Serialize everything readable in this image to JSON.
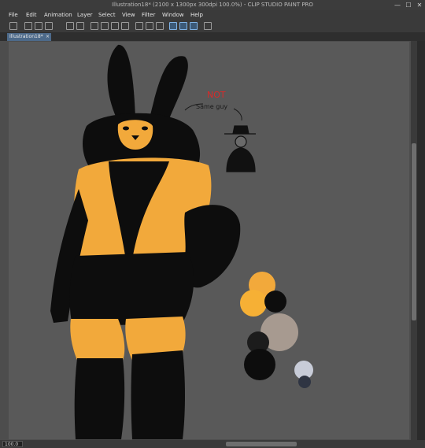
{
  "window": {
    "title": "Illustration18* (2100 x 1300px 300dpi 100.0%)  - CLIP STUDIO PAINT PRO",
    "minimize": "—",
    "maximize": "☐",
    "close": "✕"
  },
  "menu": [
    "File",
    "Edit",
    "Animation",
    "Layer",
    "Select",
    "View",
    "Filter",
    "Window",
    "Help"
  ],
  "tab": {
    "label": "Illustration18*",
    "close": "×"
  },
  "drawing": {
    "annotation_not": "NOT",
    "annotation_same": "Same guy"
  },
  "palette_swatches": [
    "#f2a93b",
    "#f6b035",
    "#0d0d0d",
    "#a79a90",
    "#1c1c1c",
    "#c8ccd8",
    "#2f3543"
  ],
  "colors": {
    "fur_black": "#0d0d0d",
    "fur_orange": "#f2a93b",
    "canvas": "#595959",
    "accent": "#4d6a8a"
  },
  "status": {
    "zoom": "100.0"
  }
}
